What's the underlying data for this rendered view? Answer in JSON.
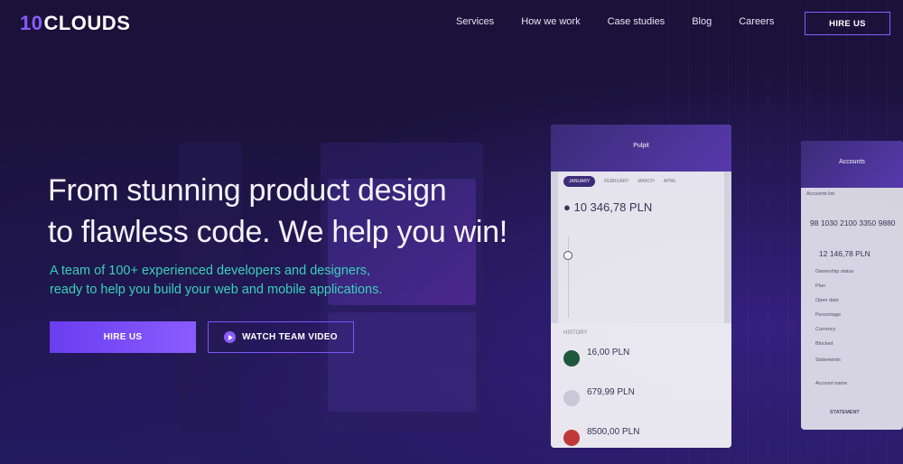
{
  "brand": {
    "logo_number": "10",
    "logo_text": "CLOUDS",
    "accent": "#8a5cff",
    "teal": "#39d0b8"
  },
  "nav": {
    "items": [
      "Services",
      "How we work",
      "Case studies",
      "Blog",
      "Careers"
    ],
    "cta": "HIRE US"
  },
  "hero": {
    "headline_line1": "From stunning product design",
    "headline_line2": "to flawless code. We help you win!",
    "sub_line1": "A team of 100+ experienced developers and designers,",
    "sub_line2": "ready to help you build your web and mobile applications.",
    "primary_button": "HIRE US",
    "secondary_button": "WATCH TEAM VIDEO",
    "secondary_icon": "play-icon"
  },
  "phone_main": {
    "title": "Pulpit",
    "tab_active": "JANUARY",
    "tabs": [
      "FEBRUARY",
      "MARCH",
      "APRIL"
    ],
    "balance": "10 346,78 PLN",
    "history_label": "HISTORY",
    "transactions": [
      "16,00 PLN",
      "679,99 PLN",
      "8500,00 PLN"
    ]
  },
  "phone_right": {
    "title": "Accounts",
    "tab": "Accounts list",
    "account_number": "98 1030 2100 3350 9880",
    "balance": "12 146,78 PLN",
    "fields": [
      "Ownership status",
      "Plan",
      "Open date",
      "Percentage",
      "Currency",
      "Blocked",
      "Statements",
      "Account name"
    ],
    "footer": "STATEMENT"
  }
}
